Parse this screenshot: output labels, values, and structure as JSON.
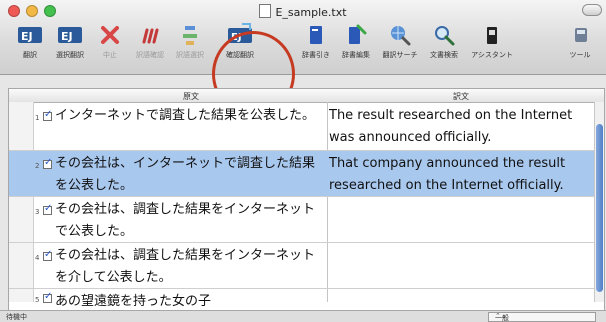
{
  "window": {
    "title": "E_sample.txt"
  },
  "toolbar": {
    "items": [
      {
        "label": "翻訳"
      },
      {
        "label": "選択翻訳"
      },
      {
        "label": "中止"
      },
      {
        "label": "訳語確認"
      },
      {
        "label": "訳語選択"
      },
      {
        "label": "確認翻訳"
      },
      {
        "label": "辞書引き"
      },
      {
        "label": "辞書編集"
      },
      {
        "label": "翻訳サーチ"
      },
      {
        "label": "文書検索"
      },
      {
        "label": "アシスタント"
      },
      {
        "label": "ツール"
      }
    ]
  },
  "table": {
    "headers": {
      "source": "原文",
      "target": "訳文"
    },
    "rows": [
      {
        "num": "1",
        "ja": "インターネットで調査した結果を公表した。",
        "en": "The result researched on the Internet was announced officially."
      },
      {
        "num": "2",
        "ja": "その会社は、インターネットで調査した結果を公表した。",
        "en": "That company announced the result researched on the Internet officially."
      },
      {
        "num": "3",
        "ja": "その会社は、調査した結果をインターネットで公表した。",
        "en": ""
      },
      {
        "num": "4",
        "ja": "その会社は、調査した結果をインターネットを介して公表した。",
        "en": ""
      },
      {
        "num": "5",
        "ja": "あの望遠鏡を持った女の子",
        "en": ""
      }
    ]
  },
  "status": {
    "text": "待機中",
    "mode": "一般"
  },
  "colors": {
    "selected_row": "#a9c8ee",
    "highlight_circle": "#c63a22"
  }
}
